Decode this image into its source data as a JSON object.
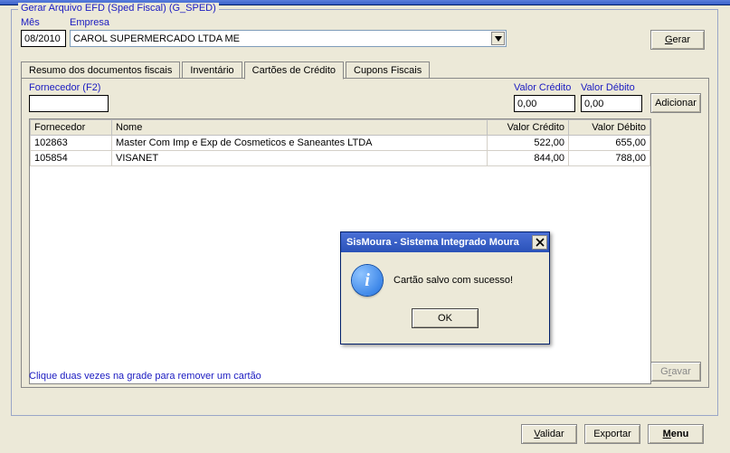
{
  "window": {
    "legend": "Gerar Arquivo EFD (Sped Fiscal) (G_SPED)"
  },
  "header": {
    "mes_label": "Mês",
    "mes_value": "08/2010",
    "empresa_label": "Empresa",
    "empresa_value": "CAROL SUPERMERCADO LTDA ME",
    "gerar_label": "Gerar"
  },
  "tabs": {
    "items": [
      {
        "label": "Resumo dos documentos fiscais"
      },
      {
        "label": "Inventário"
      },
      {
        "label": "Cartões de Crédito"
      },
      {
        "label": "Cupons Fiscais"
      }
    ],
    "active_index": 2
  },
  "cartoes": {
    "fornecedor_label": "Fornecedor (F2)",
    "fornecedor_value": "",
    "valor_credito_label": "Valor Crédito",
    "valor_credito_value": "0,00",
    "valor_debito_label": "Valor Débito",
    "valor_debito_value": "0,00",
    "adicionar_label": "Adicionar",
    "grid": {
      "headers": {
        "fornecedor": "Fornecedor",
        "nome": "Nome",
        "valor_credito": "Valor Crédito",
        "valor_debito": "Valor Débito"
      },
      "rows": [
        {
          "fornecedor": "102863",
          "nome": "Master Com Imp e Exp de Cosmeticos e Saneantes LTDA",
          "vc": "522,00",
          "vd": "655,00"
        },
        {
          "fornecedor": "105854",
          "nome": "VISANET",
          "vc": "844,00",
          "vd": "788,00"
        }
      ]
    },
    "hint": "Clique duas vezes na grade para remover um cartão",
    "gravar_label": "Gravar"
  },
  "bottom": {
    "validar_label": "Validar",
    "exportar_label": "Exportar",
    "menu_label": "Menu"
  },
  "modal": {
    "title": "SisMoura - Sistema Integrado Moura",
    "message": "Cartão salvo com sucesso!",
    "ok_label": "OK"
  }
}
